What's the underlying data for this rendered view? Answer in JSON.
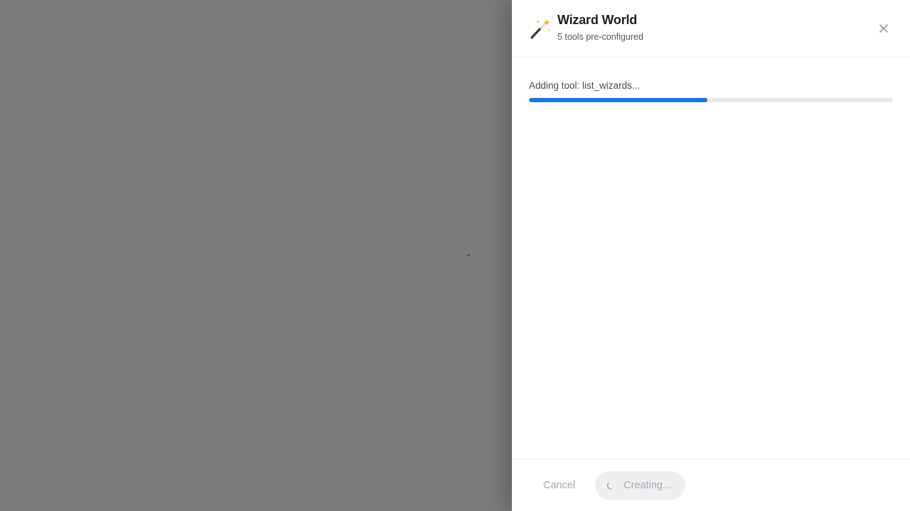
{
  "drawer": {
    "title": "Wizard World",
    "subtitle": "5 tools pre-configured",
    "header_icon": "magic-wand-icon",
    "close_icon": "close-icon"
  },
  "progress": {
    "label": "Adding tool: list_wizards...",
    "percent": 49,
    "color": "#1a73e8"
  },
  "footer": {
    "cancel_label": "Cancel",
    "creating_label": "Creating...",
    "spinner_icon": "spinner-icon"
  },
  "colors": {
    "overlay": "#7a7b7d",
    "accent": "#1a73e8"
  }
}
